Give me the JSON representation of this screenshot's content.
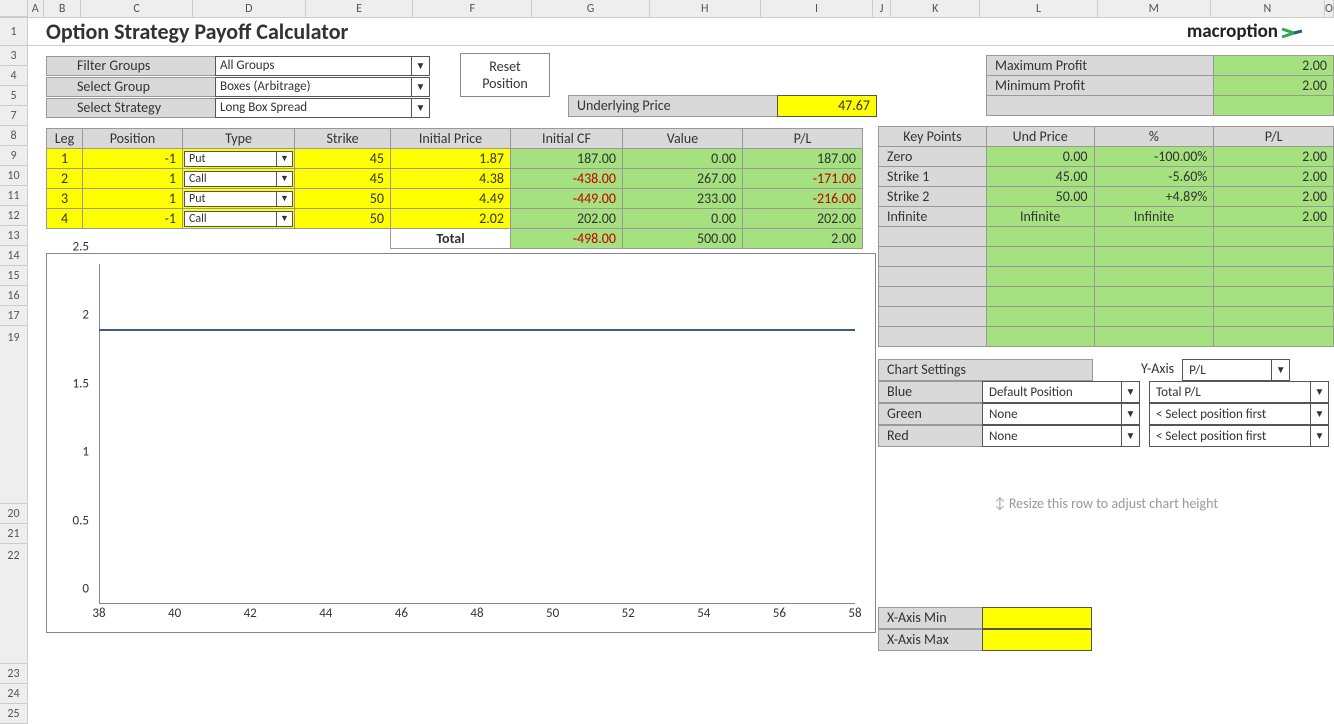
{
  "title": "Option Strategy Payoff Calculator",
  "brand": "macroption",
  "col_headers": [
    "A",
    "B",
    "C",
    "D",
    "E",
    "F",
    "G",
    "H",
    "I",
    "J",
    "K",
    "L",
    "M",
    "N",
    "O"
  ],
  "row_headers": [
    "1",
    "3",
    "4",
    "5",
    "7",
    "8",
    "9",
    "10",
    "11",
    "12",
    "13",
    "14",
    "15",
    "16",
    "17",
    "19",
    "20",
    "21",
    "22",
    "23",
    "24",
    "25"
  ],
  "controls": {
    "filter_groups_lbl": "Filter Groups",
    "filter_groups_val": "All Groups",
    "select_group_lbl": "Select Group",
    "select_group_val": "Boxes (Arbitrage)",
    "select_strategy_lbl": "Select Strategy",
    "select_strategy_val": "Long Box Spread",
    "reset_btn_l1": "Reset",
    "reset_btn_l2": "Position"
  },
  "underlying": {
    "label": "Underlying Price",
    "value": "47.67"
  },
  "legs": {
    "headers": [
      "Leg",
      "Position",
      "Type",
      "Strike",
      "Initial Price",
      "Initial CF",
      "Value",
      "P/L"
    ],
    "rows": [
      {
        "leg": "1",
        "pos": "-1",
        "type": "Put",
        "strike": "45",
        "iprice": "1.87",
        "icf": "187.00",
        "value": "0.00",
        "pl": "187.00",
        "icf_neg": false,
        "pl_neg": false
      },
      {
        "leg": "2",
        "pos": "1",
        "type": "Call",
        "strike": "45",
        "iprice": "4.38",
        "icf": "-438.00",
        "value": "267.00",
        "pl": "-171.00",
        "icf_neg": true,
        "pl_neg": true
      },
      {
        "leg": "3",
        "pos": "1",
        "type": "Put",
        "strike": "50",
        "iprice": "4.49",
        "icf": "-449.00",
        "value": "233.00",
        "pl": "-216.00",
        "icf_neg": true,
        "pl_neg": true
      },
      {
        "leg": "4",
        "pos": "-1",
        "type": "Call",
        "strike": "50",
        "iprice": "2.02",
        "icf": "202.00",
        "value": "0.00",
        "pl": "202.00",
        "icf_neg": false,
        "pl_neg": false
      }
    ],
    "total_lbl": "Total",
    "total": {
      "icf": "-498.00",
      "value": "500.00",
      "pl": "2.00",
      "icf_neg": true
    }
  },
  "profit": {
    "max_lbl": "Maximum Profit",
    "max_val": "2.00",
    "min_lbl": "Minimum Profit",
    "min_val": "2.00"
  },
  "keypoints": {
    "headers": [
      "Key Points",
      "Und Price",
      "%",
      "P/L"
    ],
    "rows": [
      {
        "k": "Zero",
        "up": "0.00",
        "pct": "-100.00%",
        "pl": "2.00"
      },
      {
        "k": "Strike 1",
        "up": "45.00",
        "pct": "-5.60%",
        "pl": "2.00"
      },
      {
        "k": "Strike 2",
        "up": "50.00",
        "pct": "+4.89%",
        "pl": "2.00"
      },
      {
        "k": "Infinite",
        "up": "Infinite",
        "pct": "Infinite",
        "pl": "2.00"
      }
    ]
  },
  "chart_settings": {
    "header": "Chart Settings",
    "yaxis_lbl": "Y-Axis",
    "yaxis_val": "P/L",
    "blue_lbl": "Blue",
    "blue_val": "Default Position",
    "blue_val2": "Total P/L",
    "green_lbl": "Green",
    "green_val": "None",
    "green_val2": "< Select position first",
    "red_lbl": "Red",
    "red_val": "None",
    "red_val2": "< Select position first"
  },
  "resize_hint": "Resize this row to adjust chart height",
  "xaxis": {
    "min_lbl": "X-Axis Min",
    "max_lbl": "X-Axis Max"
  },
  "chart_data": {
    "type": "line",
    "x_ticks": [
      "38",
      "40",
      "42",
      "44",
      "46",
      "48",
      "50",
      "52",
      "54",
      "56",
      "58"
    ],
    "y_ticks": [
      "0",
      "0.5",
      "1",
      "1.5",
      "2",
      "2.5"
    ],
    "xlim": [
      38,
      58
    ],
    "ylim": [
      0,
      2.5
    ],
    "series": [
      {
        "name": "Blue",
        "color": "#3a5a88",
        "values": [
          2,
          2,
          2,
          2,
          2,
          2,
          2,
          2,
          2,
          2,
          2
        ]
      }
    ]
  }
}
